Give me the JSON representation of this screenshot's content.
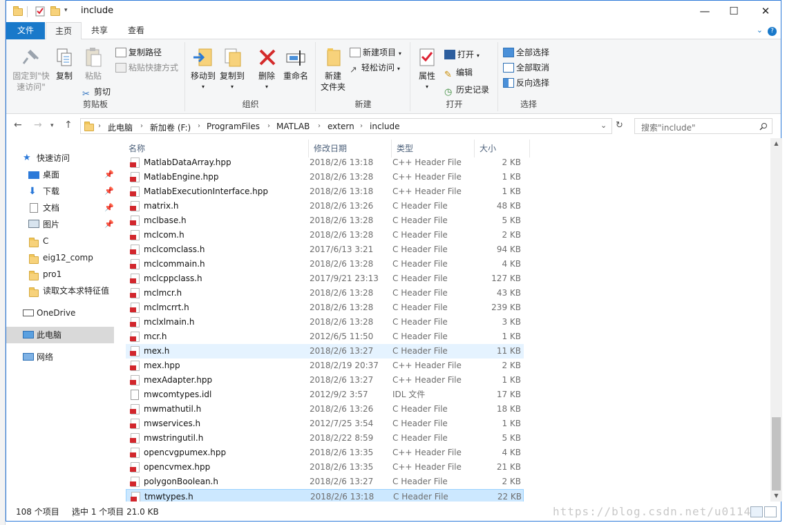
{
  "window": {
    "title": "include",
    "controls": {
      "minimize": "—",
      "maximize": "☐",
      "close": "✕"
    }
  },
  "ribbon_tabs": [
    "文件",
    "主页",
    "共享",
    "查看"
  ],
  "ribbon": {
    "clipboard": {
      "label": "剪贴板",
      "pin": "固定到\"快\n速访问\"",
      "copy": "复制",
      "paste": "粘贴",
      "copy_path": "复制路径",
      "paste_shortcut": "粘贴快捷方式",
      "cut": "剪切"
    },
    "organize": {
      "label": "组织",
      "move_to": "移动到",
      "copy_to": "复制到",
      "delete": "删除",
      "rename": "重命名"
    },
    "new": {
      "label": "新建",
      "new_folder": "新建\n文件夹",
      "new_item": "新建项目",
      "easy_access": "轻松访问"
    },
    "open": {
      "label": "打开",
      "properties": "属性",
      "open": "打开",
      "edit": "编辑",
      "history": "历史记录"
    },
    "select": {
      "label": "选择",
      "select_all": "全部选择",
      "select_none": "全部取消",
      "invert": "反向选择"
    }
  },
  "address": {
    "crumbs": [
      "此电脑",
      "新加卷 (F:)",
      "ProgramFiles",
      "MATLAB",
      "extern",
      "include"
    ],
    "search_placeholder": "搜索\"include\""
  },
  "nav": {
    "quick_access": "快速访问",
    "items": [
      "桌面",
      "下载",
      "文档",
      "图片",
      "C",
      "eig12_comp",
      "pro1",
      "读取文本求特征值"
    ],
    "onedrive": "OneDrive",
    "this_pc": "此电脑",
    "network": "网络"
  },
  "columns": {
    "name": "名称",
    "date": "修改日期",
    "type": "类型",
    "size": "大小"
  },
  "files": [
    {
      "name": "MatlabDataArray.hpp",
      "date": "2018/2/6 13:18",
      "type": "C++ Header File",
      "size": "2 KB",
      "icon": "h"
    },
    {
      "name": "MatlabEngine.hpp",
      "date": "2018/2/6 13:28",
      "type": "C++ Header File",
      "size": "1 KB",
      "icon": "h"
    },
    {
      "name": "MatlabExecutionInterface.hpp",
      "date": "2018/2/6 13:18",
      "type": "C++ Header File",
      "size": "1 KB",
      "icon": "h"
    },
    {
      "name": "matrix.h",
      "date": "2018/2/6 13:26",
      "type": "C Header File",
      "size": "48 KB",
      "icon": "h"
    },
    {
      "name": "mclbase.h",
      "date": "2018/2/6 13:28",
      "type": "C Header File",
      "size": "5 KB",
      "icon": "h"
    },
    {
      "name": "mclcom.h",
      "date": "2018/2/6 13:28",
      "type": "C Header File",
      "size": "2 KB",
      "icon": "h"
    },
    {
      "name": "mclcomclass.h",
      "date": "2017/6/13 3:21",
      "type": "C Header File",
      "size": "94 KB",
      "icon": "h"
    },
    {
      "name": "mclcommain.h",
      "date": "2018/2/6 13:28",
      "type": "C Header File",
      "size": "4 KB",
      "icon": "h"
    },
    {
      "name": "mclcppclass.h",
      "date": "2017/9/21 23:13",
      "type": "C Header File",
      "size": "127 KB",
      "icon": "h"
    },
    {
      "name": "mclmcr.h",
      "date": "2018/2/6 13:28",
      "type": "C Header File",
      "size": "43 KB",
      "icon": "h"
    },
    {
      "name": "mclmcrrt.h",
      "date": "2018/2/6 13:28",
      "type": "C Header File",
      "size": "239 KB",
      "icon": "h"
    },
    {
      "name": "mclxlmain.h",
      "date": "2018/2/6 13:28",
      "type": "C Header File",
      "size": "3 KB",
      "icon": "h"
    },
    {
      "name": "mcr.h",
      "date": "2012/6/5 11:50",
      "type": "C Header File",
      "size": "1 KB",
      "icon": "h"
    },
    {
      "name": "mex.h",
      "date": "2018/2/6 13:27",
      "type": "C Header File",
      "size": "11 KB",
      "icon": "h",
      "state": "hover"
    },
    {
      "name": "mex.hpp",
      "date": "2018/2/19 20:37",
      "type": "C++ Header File",
      "size": "2 KB",
      "icon": "h"
    },
    {
      "name": "mexAdapter.hpp",
      "date": "2018/2/6 13:27",
      "type": "C++ Header File",
      "size": "1 KB",
      "icon": "h"
    },
    {
      "name": "mwcomtypes.idl",
      "date": "2012/9/2 3:57",
      "type": "IDL 文件",
      "size": "17 KB",
      "icon": "plain"
    },
    {
      "name": "mwmathutil.h",
      "date": "2018/2/6 13:26",
      "type": "C Header File",
      "size": "18 KB",
      "icon": "h"
    },
    {
      "name": "mwservices.h",
      "date": "2012/7/25 3:54",
      "type": "C Header File",
      "size": "1 KB",
      "icon": "h"
    },
    {
      "name": "mwstringutil.h",
      "date": "2018/2/22 8:59",
      "type": "C Header File",
      "size": "5 KB",
      "icon": "h"
    },
    {
      "name": "opencvgpumex.hpp",
      "date": "2018/2/6 13:35",
      "type": "C++ Header File",
      "size": "4 KB",
      "icon": "h"
    },
    {
      "name": "opencvmex.hpp",
      "date": "2018/2/6 13:35",
      "type": "C++ Header File",
      "size": "21 KB",
      "icon": "h"
    },
    {
      "name": "polygonBoolean.h",
      "date": "2018/2/6 13:27",
      "type": "C Header File",
      "size": "2 KB",
      "icon": "h"
    },
    {
      "name": "tmwtypes.h",
      "date": "2018/2/6 13:18",
      "type": "C Header File",
      "size": "22 KB",
      "icon": "h",
      "state": "selected"
    }
  ],
  "status": {
    "count": "108 个项目",
    "selection": "选中 1 个项目  21.0 KB"
  },
  "watermark": "https://blog.csdn.net/u0114",
  "colors": {
    "accent": "#1979ca",
    "selected_row": "#cce8ff",
    "hover_row": "#e5f3ff",
    "header_text": "#4c607a"
  }
}
